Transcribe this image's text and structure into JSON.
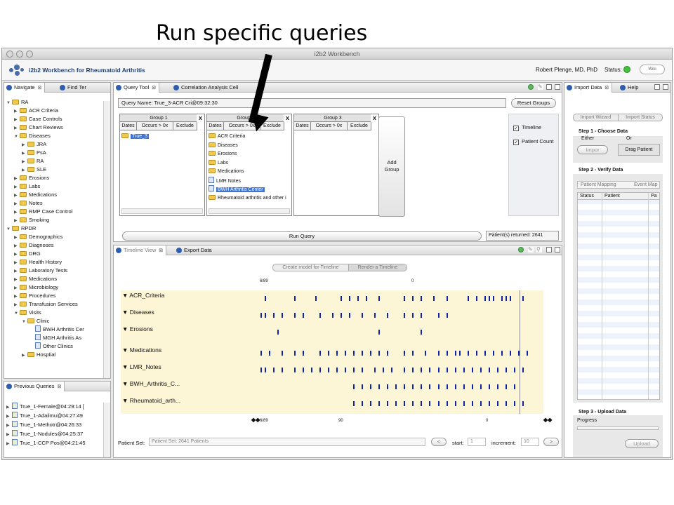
{
  "slide_title": "Run specific queries",
  "window_title": "i2b2 Workbench",
  "app": {
    "title": "i2b2 Workbench for Rheumatoid Arthritis",
    "user": "Robert Plenge, MD, PhD",
    "status_label": "Status:",
    "status_color": "#43c13a",
    "wiki_label": "Wiki"
  },
  "navigate": {
    "tabs": [
      "Navigate",
      "Find Ter"
    ],
    "tree": [
      {
        "label": "RA",
        "level": 0,
        "open": true
      },
      {
        "label": "ACR Criteria",
        "level": 1
      },
      {
        "label": "Case Controls",
        "level": 1
      },
      {
        "label": "Chart Reviews",
        "level": 1
      },
      {
        "label": "Diseases",
        "level": 1,
        "open": true
      },
      {
        "label": "JRA",
        "level": 2
      },
      {
        "label": "PsA",
        "level": 2
      },
      {
        "label": "RA",
        "level": 2
      },
      {
        "label": "SLE",
        "level": 2
      },
      {
        "label": "Erosions",
        "level": 1
      },
      {
        "label": "Labs",
        "level": 1
      },
      {
        "label": "Medications",
        "level": 1
      },
      {
        "label": "Notes",
        "level": 1
      },
      {
        "label": "RMP Case Control",
        "level": 1
      },
      {
        "label": "Smoking",
        "level": 1
      },
      {
        "label": "RPDR",
        "level": 0,
        "open": true
      },
      {
        "label": "Demographics",
        "level": 1
      },
      {
        "label": "Diagnoses",
        "level": 1
      },
      {
        "label": "DRG",
        "level": 1
      },
      {
        "label": "Health History",
        "level": 1
      },
      {
        "label": "Laboratory Tests",
        "level": 1
      },
      {
        "label": "Medications",
        "level": 1
      },
      {
        "label": "Microbiology",
        "level": 1
      },
      {
        "label": "Procedures",
        "level": 1
      },
      {
        "label": "Transfusion Services",
        "level": 1
      },
      {
        "label": "Visits",
        "level": 1,
        "open": true
      },
      {
        "label": "Clinic",
        "level": 2,
        "open": true
      },
      {
        "label": "BWH Arthritis Cer",
        "level": 3,
        "doc": true
      },
      {
        "label": "MGH Arthritis As",
        "level": 3,
        "doc": true
      },
      {
        "label": "Other Clinics",
        "level": 3,
        "doc": true
      },
      {
        "label": "Hosptial",
        "level": 2
      }
    ]
  },
  "previous_queries": {
    "tab": "Previous Queries",
    "items": [
      "True_1-Female@04:29:14 [",
      "True_1-Adalimu@04:27:49",
      "True_1-Methotr@04:26:33",
      "True_1-Nodules@04:25:37",
      "True_1-CCP Pos@04:21:45"
    ]
  },
  "query_tool": {
    "tabs": [
      "Query Tool",
      "Correlation Analysis Cell"
    ],
    "query_name": "Query Name: True_3-ACR Cri@09:32:30",
    "reset_label": "Reset Groups",
    "groups": [
      {
        "title": "Group 1",
        "items": [
          "True_3"
        ],
        "selected": 0
      },
      {
        "title": "Group 2",
        "items": [
          "ACR Criteria",
          "Diseases",
          "Erosions",
          "Labs",
          "Medications",
          "LMR Notes",
          "BWH Arthritis Center",
          "Rheumatoid arthritis and other i"
        ],
        "selected": 6
      },
      {
        "title": "Group 3",
        "items": [],
        "selected": -1
      }
    ],
    "group_options": [
      "Dates",
      "Occurs > 0x",
      "Exclude"
    ],
    "remove_label": "x",
    "add_group_label": "Add Group",
    "timeline_label": "Timeline",
    "patient_count_label": "Patient Count",
    "run_label": "Run Query",
    "returned": "Patient(s) returned: 2641"
  },
  "timeline": {
    "tabs": [
      "Timeline View",
      "Export Data"
    ],
    "buttons": [
      "Create model for Timeline",
      "Render a Timeline"
    ],
    "top_ticks": [
      "6/89",
      "0"
    ],
    "bottom_ticks": [
      "6/89",
      "90",
      "0"
    ],
    "rows": [
      {
        "label": "▼ ACR_Criteria",
        "marks": [
          0.34,
          0.41,
          0.46,
          0.52,
          0.54,
          0.56,
          0.58,
          0.61,
          0.67,
          0.69,
          0.71,
          0.74,
          0.77,
          0.82,
          0.84,
          0.86,
          0.87,
          0.88,
          0.9,
          0.91,
          0.92,
          0.95
        ]
      },
      {
        "label": "▼ Diseases",
        "marks": [
          0.33,
          0.34,
          0.36,
          0.38,
          0.41,
          0.43,
          0.47,
          0.5,
          0.52,
          0.54,
          0.57,
          0.6,
          0.63,
          0.67,
          0.69,
          0.71,
          0.75,
          0.77
        ]
      },
      {
        "label": "▼ Erosions",
        "marks": [
          0.37,
          0.61,
          0.71
        ]
      },
      {
        "label": "▼ Medications",
        "marks": [
          0.33,
          0.35,
          0.38,
          0.41,
          0.43,
          0.47,
          0.49,
          0.51,
          0.53,
          0.55,
          0.57,
          0.59,
          0.61,
          0.63,
          0.67,
          0.69,
          0.72,
          0.75,
          0.77,
          0.79,
          0.8,
          0.82,
          0.84,
          0.86,
          0.88,
          0.9,
          0.92,
          0.94,
          0.96
        ]
      },
      {
        "label": "▼ LMR_Notes",
        "marks": [
          0.33,
          0.34,
          0.36,
          0.38,
          0.41,
          0.43,
          0.45,
          0.47,
          0.49,
          0.51,
          0.53,
          0.55,
          0.57,
          0.6,
          0.62,
          0.64,
          0.67,
          0.69,
          0.71,
          0.73,
          0.75,
          0.77,
          0.79,
          0.81,
          0.83,
          0.85,
          0.87,
          0.89,
          0.91,
          0.93,
          0.95
        ]
      },
      {
        "label": "▼ BWH_Arthritis_C...",
        "marks": [
          0.55,
          0.57,
          0.59,
          0.61,
          0.63,
          0.65,
          0.67,
          0.69,
          0.71,
          0.73,
          0.75,
          0.77,
          0.79,
          0.81,
          0.83,
          0.85,
          0.87,
          0.89,
          0.91,
          0.93
        ]
      },
      {
        "label": "▼ Rheumatoid_arth...",
        "marks": [
          0.55,
          0.57,
          0.59,
          0.61,
          0.63,
          0.65,
          0.67,
          0.69,
          0.71,
          0.73,
          0.75,
          0.77,
          0.79,
          0.81,
          0.83,
          0.85,
          0.87,
          0.89,
          0.91,
          0.93,
          0.95
        ]
      }
    ],
    "patient_set_label": "Patient Set:",
    "patient_set_value": "Patient Set: 2641 Patients",
    "start_label": "start:",
    "start_value": "1",
    "increment_label": "increment:",
    "increment_value": "10"
  },
  "import": {
    "tabs": [
      "Import Data",
      "Help"
    ],
    "subtabs": [
      "Import Wizard",
      "Import Status"
    ],
    "step1": "Step 1 - Choose Data",
    "either": "Either",
    "or": "Or",
    "import_btn": "Impor",
    "drag_btn": "Drag Patient",
    "step2": "Step 2 - Verify Data",
    "verify_tabs": [
      "Patient Mapping",
      "Event Map"
    ],
    "columns": [
      "Status",
      "Patient",
      "Pa"
    ],
    "step3": "Step 3 - Upload Data",
    "progress": "Progress",
    "upload": "Upload"
  }
}
